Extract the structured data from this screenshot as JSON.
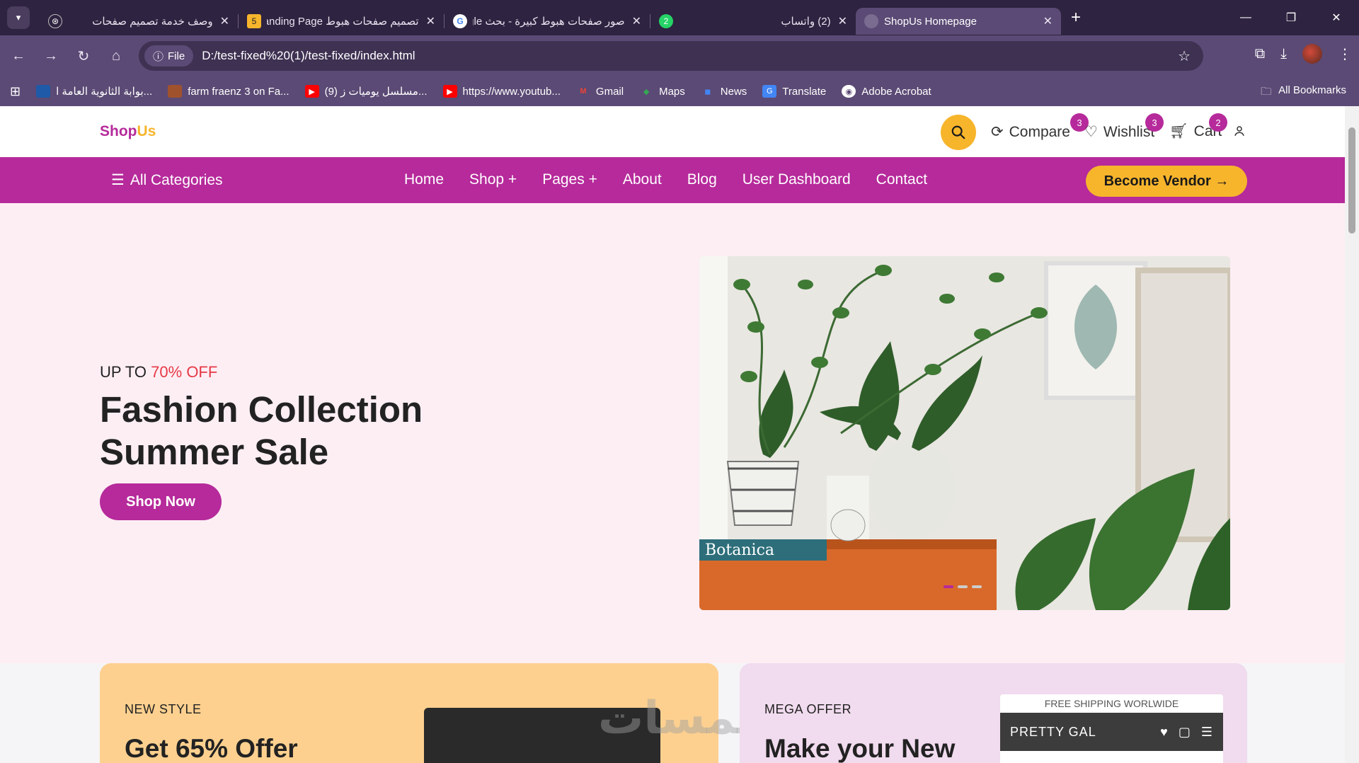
{
  "browser": {
    "tabs": [
      {
        "title": "وصف خدمة تصميم صفحات",
        "icon": "openai-icon",
        "fav_color": "#2e2340",
        "active": false
      },
      {
        "title": "تصميم صفحات هبوط Landing Page",
        "icon": "khamsat-icon",
        "fav_color": "#f7b52c",
        "active": false
      },
      {
        "title": "صور صفحات هبوط كبيرة - بحث Google",
        "icon": "google-icon",
        "fav_color": "#ffffff",
        "active": false
      },
      {
        "title": "(2) واتساب",
        "icon": "whatsapp-icon",
        "fav_color": "#25d366",
        "active": false
      },
      {
        "title": "ShopUs Homepage",
        "icon": "globe-icon",
        "fav_color": "#7a6b90",
        "active": true
      }
    ],
    "whatsapp_badge": "2",
    "khamsat_badge": "5",
    "file_label": "File",
    "url": "D:/test-fixed%20(1)/test-fixed/index.html",
    "bookmarks": [
      {
        "label": "بوابة الثانوية العامة ا...",
        "icon": "school-icon",
        "color": "#1e5aa8"
      },
      {
        "label": "farm fraenz 3 on Fa...",
        "icon": "facebook-photo-icon",
        "color": "#a0522d"
      },
      {
        "label": "(9) مسلسل يوميات ز...",
        "icon": "youtube-icon",
        "color": "#ff0000"
      },
      {
        "label": "https://www.youtub...",
        "icon": "youtube-icon",
        "color": "#ff0000"
      },
      {
        "label": "Gmail",
        "icon": "gmail-icon",
        "color": "#ea4335"
      },
      {
        "label": "Maps",
        "icon": "maps-icon",
        "color": "#34a853"
      },
      {
        "label": "News",
        "icon": "news-icon",
        "color": "#4285f4"
      },
      {
        "label": "Translate",
        "icon": "translate-icon",
        "color": "#4285f4"
      },
      {
        "label": "Adobe Acrobat",
        "icon": "acrobat-icon",
        "color": "#ffffff"
      }
    ],
    "all_bookmarks": "All Bookmarks"
  },
  "site": {
    "logo_shop": "Shop",
    "logo_us": "Us",
    "header": {
      "compare": "Compare",
      "compare_count": "3",
      "wishlist": "Wishlist",
      "wishlist_count": "3",
      "cart": "Cart",
      "cart_count": "2"
    },
    "nav": {
      "all_categories": "All Categories",
      "links": [
        "Home",
        "Shop +",
        "Pages +",
        "About",
        "Blog",
        "User Dashboard",
        "Contact"
      ],
      "vendor": "Become Vendor →"
    },
    "hero": {
      "sub_prefix": "UP TO",
      "sub_off": "70% OFF",
      "title_line1": "Fashion Collection",
      "title_line2": "Summer Sale",
      "cta": "Shop Now",
      "image_caption": "Botanica"
    },
    "promos": [
      {
        "eyebrow": "NEW STYLE",
        "title": "Get 65% Offer"
      },
      {
        "eyebrow": "MEGA OFFER",
        "title": "Make your New",
        "card_ship": "FREE SHIPPING WORLWIDE",
        "card_brand": "PRETTY GAL"
      }
    ],
    "watermark": "خمسات"
  },
  "colors": {
    "brand": "#b62a9b",
    "accent": "#f7b52c",
    "sale": "#e63946"
  }
}
